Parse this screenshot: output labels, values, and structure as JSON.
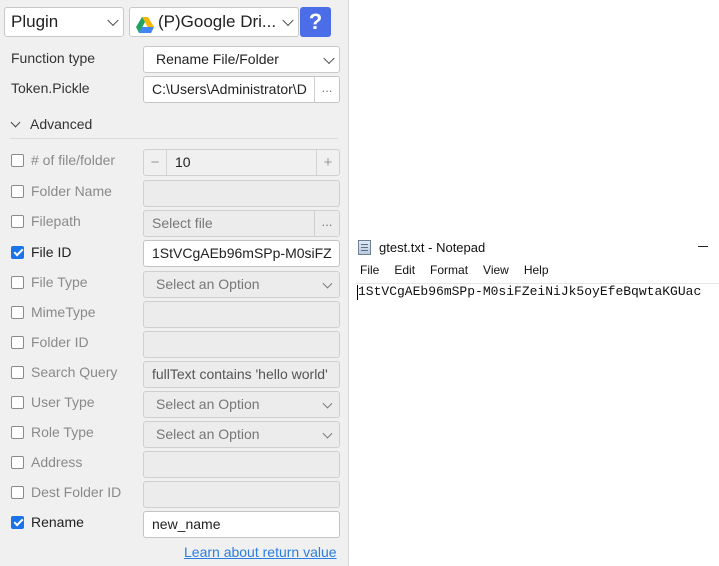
{
  "plugin_select": {
    "value": "Plugin"
  },
  "service_select": {
    "value": "(P)Google Dri...",
    "icon": "google-drive-icon"
  },
  "help_button": {
    "label": "?",
    "color": "#4b6ee8"
  },
  "function_type": {
    "label": "Function type",
    "value": "Rename File/Folder"
  },
  "token_pickle": {
    "label": "Token.Pickle",
    "value": "C:\\Users\\Administrator\\D",
    "browse": "..."
  },
  "advanced": {
    "label": "Advanced"
  },
  "fields": {
    "num_files": {
      "label": "# of file/folder",
      "checked": false,
      "value": "10",
      "minus": "−",
      "plus": "+"
    },
    "folder_name": {
      "label": "Folder Name",
      "checked": false,
      "value": ""
    },
    "filepath": {
      "label": "Filepath",
      "checked": false,
      "value": "Select file",
      "browse": "..."
    },
    "file_id": {
      "label": "File ID",
      "checked": true,
      "value": "1StVCgAEb96mSPp-M0siFZ"
    },
    "file_type": {
      "label": "File Type",
      "checked": false,
      "value": "Select an Option"
    },
    "mime_type": {
      "label": "MimeType",
      "checked": false,
      "value": ""
    },
    "folder_id": {
      "label": "Folder ID",
      "checked": false,
      "value": ""
    },
    "search_query": {
      "label": "Search Query",
      "checked": false,
      "value": "fullText contains 'hello world'"
    },
    "user_type": {
      "label": "User Type",
      "checked": false,
      "value": "Select an Option"
    },
    "role_type": {
      "label": "Role Type",
      "checked": false,
      "value": "Select an Option"
    },
    "address": {
      "label": "Address",
      "checked": false,
      "value": ""
    },
    "dest_folder_id": {
      "label": "Dest Folder ID",
      "checked": false,
      "value": ""
    },
    "rename": {
      "label": "Rename",
      "checked": true,
      "value": "new_name"
    }
  },
  "learn_link": "Learn about return value",
  "notepad": {
    "title": "gtest.txt - Notepad",
    "menu": [
      "File",
      "Edit",
      "Format",
      "View",
      "Help"
    ],
    "content": "1StVCgAEb96mSPp-M0siFZeiNiJk5oyEfeBqwtaKGUac"
  },
  "colors": {
    "accent": "#1a73e8",
    "link": "#2a7de1"
  }
}
